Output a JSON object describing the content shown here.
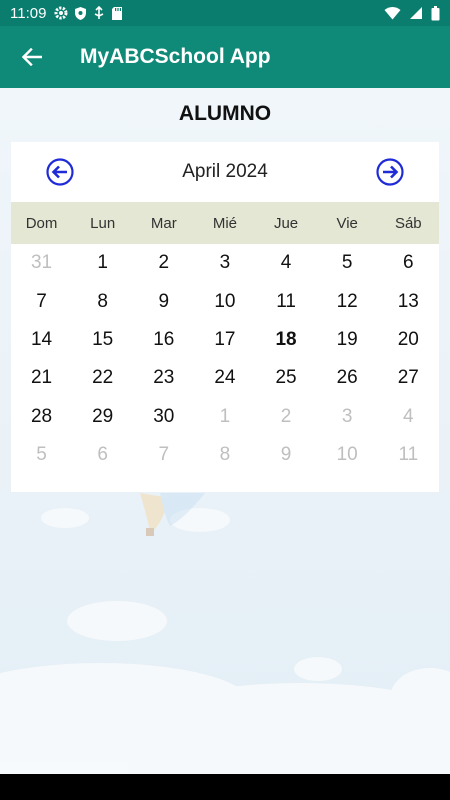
{
  "status_bar": {
    "time": "11:09",
    "left_icons": [
      "gear-icon",
      "shield-icon",
      "usb-debug-icon",
      "sd-card-icon"
    ],
    "right_icons": [
      "wifi-icon",
      "signal-icon",
      "battery-icon"
    ]
  },
  "app_bar": {
    "title": "MyABCSchool App",
    "background": "#0f8a78"
  },
  "page": {
    "heading": "ALUMNO"
  },
  "calendar": {
    "month_label": "April 2024",
    "weekdays": [
      "Dom",
      "Lun",
      "Mar",
      "Mié",
      "Jue",
      "Vie",
      "Sáb"
    ],
    "header_bg": "#e4e7d3",
    "nav_color": "#1f2bd6",
    "days": [
      {
        "d": "31",
        "other": true
      },
      {
        "d": "1"
      },
      {
        "d": "2"
      },
      {
        "d": "3"
      },
      {
        "d": "4"
      },
      {
        "d": "5"
      },
      {
        "d": "6"
      },
      {
        "d": "7"
      },
      {
        "d": "8"
      },
      {
        "d": "9"
      },
      {
        "d": "10"
      },
      {
        "d": "11"
      },
      {
        "d": "12"
      },
      {
        "d": "13"
      },
      {
        "d": "14"
      },
      {
        "d": "15"
      },
      {
        "d": "16"
      },
      {
        "d": "17"
      },
      {
        "d": "18",
        "today": true
      },
      {
        "d": "19"
      },
      {
        "d": "20"
      },
      {
        "d": "21"
      },
      {
        "d": "22"
      },
      {
        "d": "23"
      },
      {
        "d": "24"
      },
      {
        "d": "25"
      },
      {
        "d": "26"
      },
      {
        "d": "27"
      },
      {
        "d": "28"
      },
      {
        "d": "29"
      },
      {
        "d": "30"
      },
      {
        "d": "1",
        "other": true
      },
      {
        "d": "2",
        "other": true
      },
      {
        "d": "3",
        "other": true
      },
      {
        "d": "4",
        "other": true
      },
      {
        "d": "5",
        "other": true
      },
      {
        "d": "6",
        "other": true
      },
      {
        "d": "7",
        "other": true
      },
      {
        "d": "8",
        "other": true
      },
      {
        "d": "9",
        "other": true
      },
      {
        "d": "10",
        "other": true
      },
      {
        "d": "11",
        "other": true
      }
    ]
  }
}
